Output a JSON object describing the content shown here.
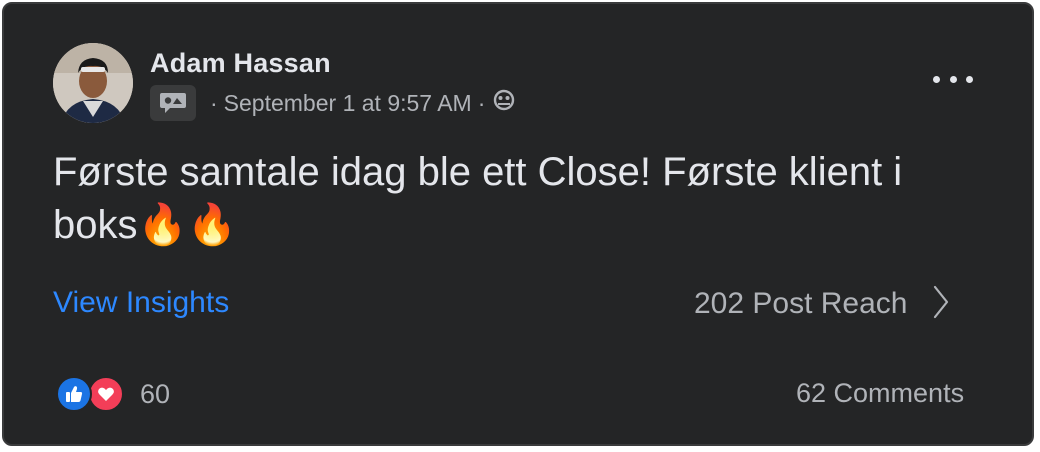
{
  "post": {
    "author": "Adam Hassan",
    "timestamp": "September 1 at 9:57 AM",
    "separator": "·",
    "badge_icon": "chat-bubble-icon",
    "privacy_icon": "group-audience-icon",
    "more_icon": "more-options-icon",
    "text": "Første samtale idag ble ett Close! Første klient i boks🔥🔥",
    "insights_label": "View Insights",
    "reach_label": "202 Post Reach",
    "reaction_count": "60",
    "comments_label": "62 Comments"
  },
  "colors": {
    "card_bg": "#242526",
    "primary_text": "#e4e6eb",
    "secondary_text": "#b0b3b8",
    "link": "#2d88ff",
    "like": "#1b74e4",
    "love": "#f33e58"
  }
}
